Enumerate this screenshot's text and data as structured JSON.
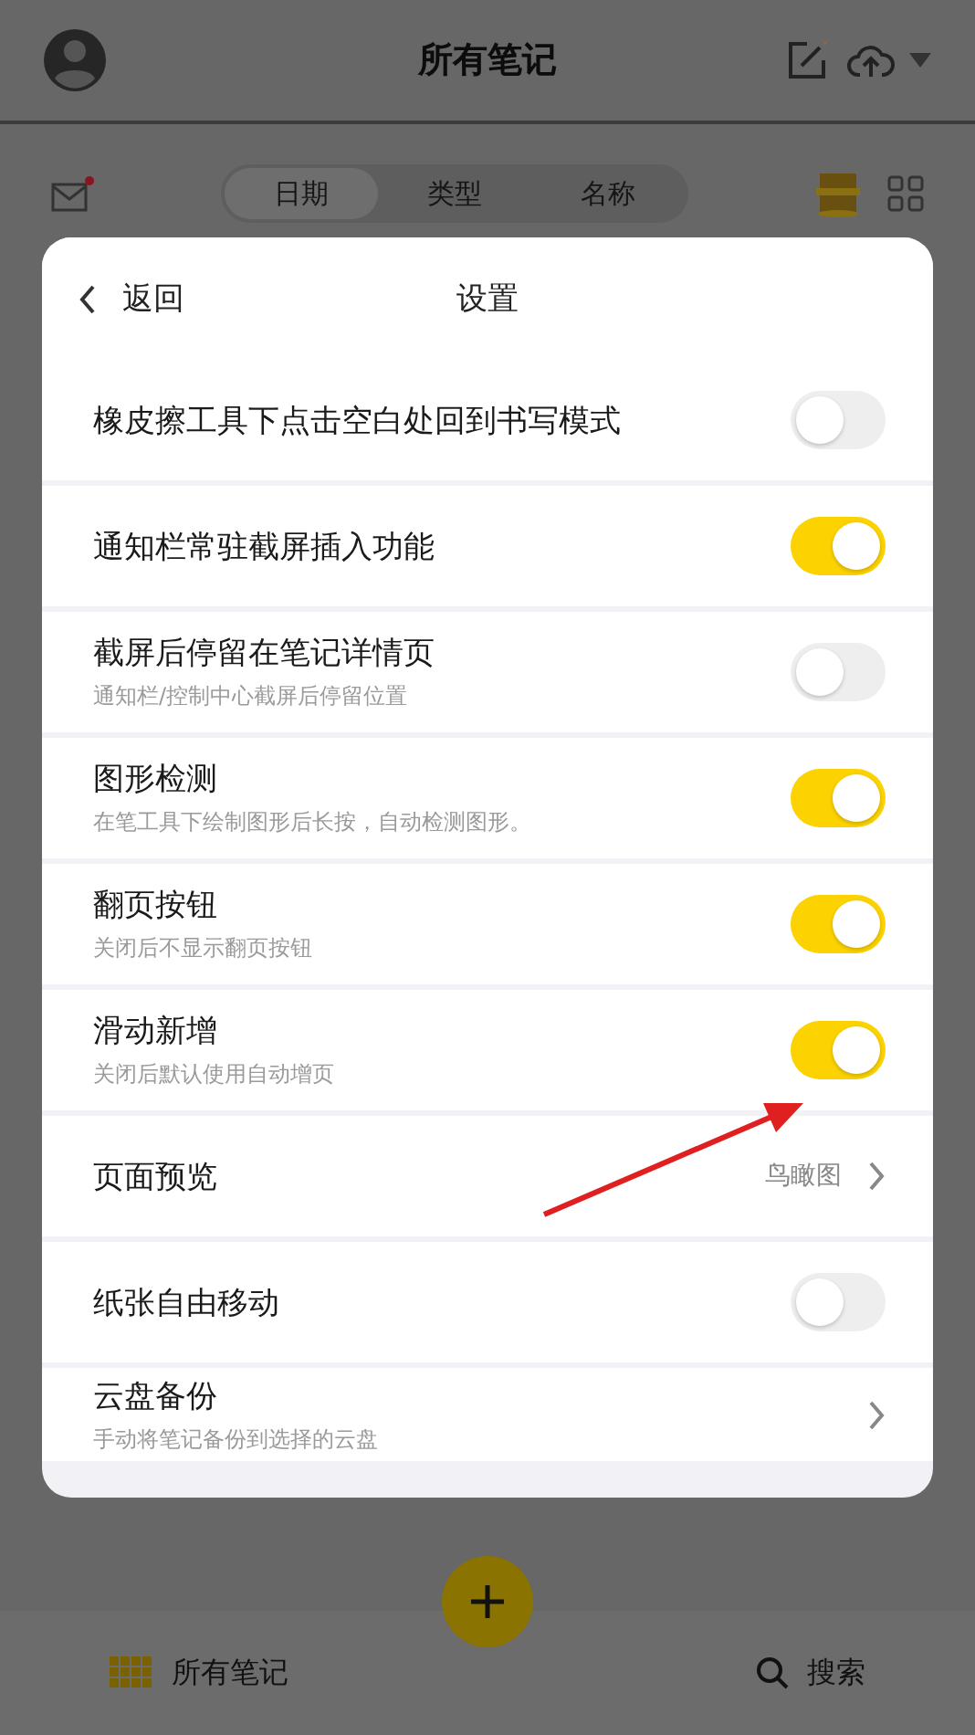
{
  "header": {
    "title": "所有笔记"
  },
  "sort_tabs": [
    {
      "label": "日期",
      "selected": true
    },
    {
      "label": "类型",
      "selected": false
    },
    {
      "label": "名称",
      "selected": false
    }
  ],
  "settings": {
    "back": "返回",
    "title": "设置",
    "rows": [
      {
        "kind": "toggle",
        "title": "橡皮擦工具下点击空白处回到书写模式",
        "on": false
      },
      {
        "kind": "toggle",
        "title": "通知栏常驻截屏插入功能",
        "on": true
      },
      {
        "kind": "toggle",
        "title": "截屏后停留在笔记详情页",
        "subtitle": "通知栏/控制中心截屏后停留位置",
        "on": false
      },
      {
        "kind": "toggle",
        "title": "图形检测",
        "subtitle": "在笔工具下绘制图形后长按，自动检测图形。",
        "on": true
      },
      {
        "kind": "toggle",
        "title": "翻页按钮",
        "subtitle": "关闭后不显示翻页按钮",
        "on": true
      },
      {
        "kind": "toggle",
        "title": "滑动新增",
        "subtitle": "关闭后默认使用自动增页",
        "on": true
      },
      {
        "kind": "link",
        "title": "页面预览",
        "value": "鸟瞰图"
      },
      {
        "kind": "toggle",
        "title": "纸张自由移动",
        "on": false
      },
      {
        "kind": "link",
        "title": "云盘备份",
        "subtitle": "手动将笔记备份到选择的云盘"
      }
    ]
  },
  "bottom_bar": {
    "notes": "所有笔记",
    "search": "搜索"
  }
}
